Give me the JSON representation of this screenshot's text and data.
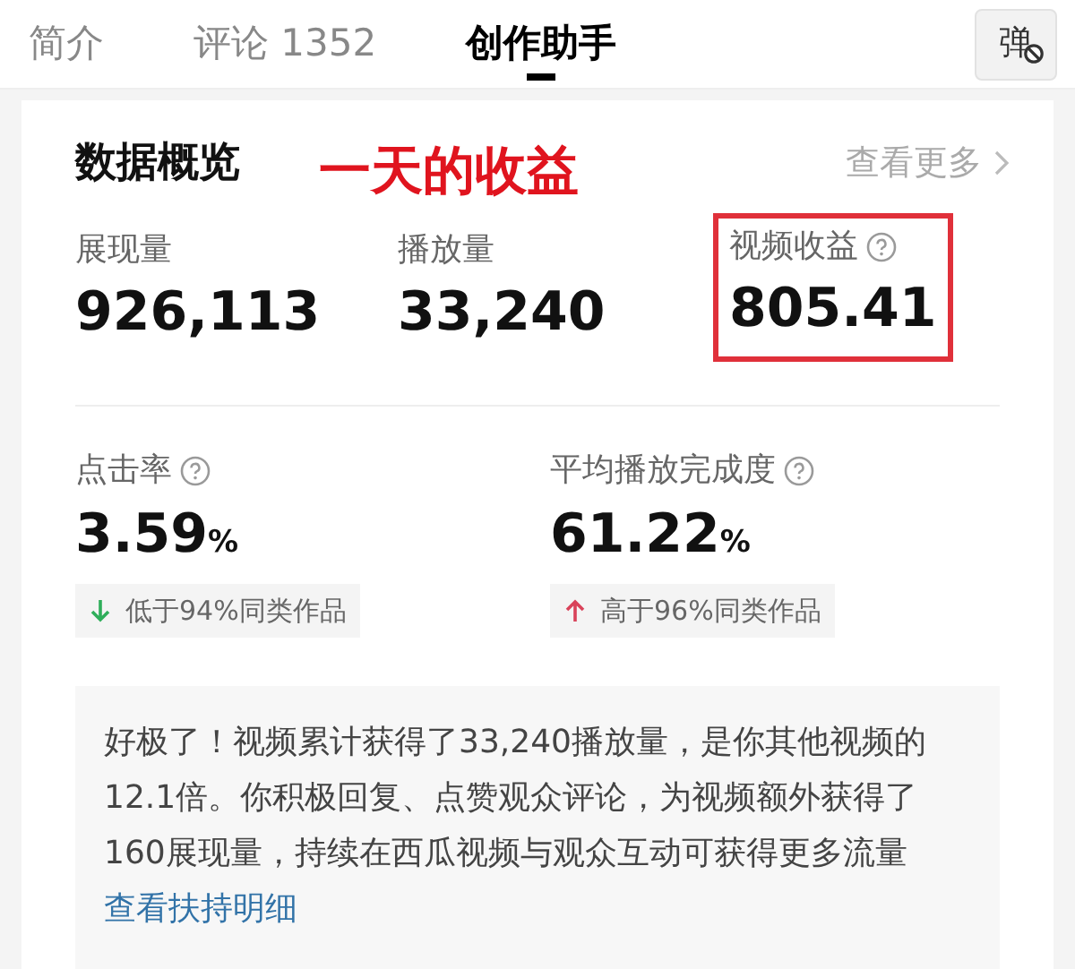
{
  "tabs": [
    {
      "label": "简介",
      "selected": false
    },
    {
      "label": "评论 1352",
      "selected": false
    },
    {
      "label": "创作助手",
      "selected": true
    }
  ],
  "danmaku_button": {
    "label": "弹"
  },
  "overview": {
    "title": "数据概览",
    "annotation": "一天的收益",
    "more_link": "查看更多",
    "metrics": [
      {
        "label": "展现量",
        "value": "926,113",
        "help": false,
        "highlighted": false
      },
      {
        "label": "播放量",
        "value": "33,240",
        "help": false,
        "highlighted": false
      },
      {
        "label": "视频收益",
        "value": "805.41",
        "help": true,
        "highlighted": true
      }
    ],
    "rates": [
      {
        "label": "点击率",
        "value": "3.59",
        "unit": "%",
        "kind": "down",
        "comparison": "低于94%同类作品"
      },
      {
        "label": "平均播放完成度",
        "value": "61.22",
        "unit": "%",
        "kind": "up",
        "comparison": "高于96%同类作品"
      }
    ],
    "message": {
      "text": "好极了！视频累计获得了33,240播放量，是你其他视频的12.1倍。你积极回复、点赞观众评论，为视频额外获得了160展现量，持续在西瓜视频与观众互动可获得更多流量",
      "link": "查看扶持明细"
    }
  }
}
